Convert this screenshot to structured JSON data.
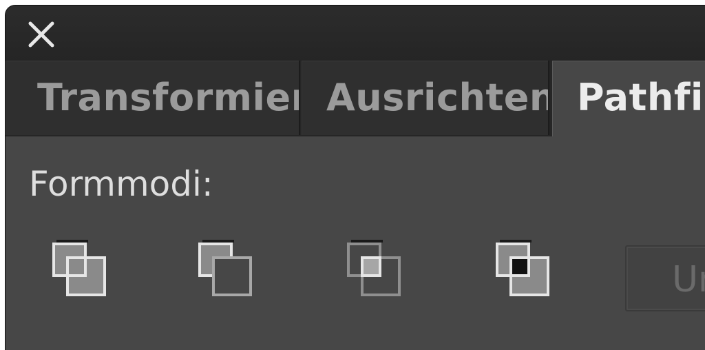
{
  "window": {
    "close_icon": "close-icon"
  },
  "tabs": [
    {
      "label": "Transformieren",
      "active": false
    },
    {
      "label": "Ausrichten",
      "active": false
    },
    {
      "label": "Pathfinder",
      "active": true
    }
  ],
  "content": {
    "section_label": "Formmodi:",
    "shape_modes": [
      {
        "icon": "unite-icon"
      },
      {
        "icon": "minus-front-icon"
      },
      {
        "icon": "intersect-icon"
      },
      {
        "icon": "exclude-icon"
      }
    ],
    "apply_button_label": "Umwandeln"
  },
  "colors": {
    "panel_bg": "#474747",
    "titlebar_bg": "#252525",
    "active_tab_text": "#ececec",
    "inactive_tab_text": "#9b9b9b"
  }
}
